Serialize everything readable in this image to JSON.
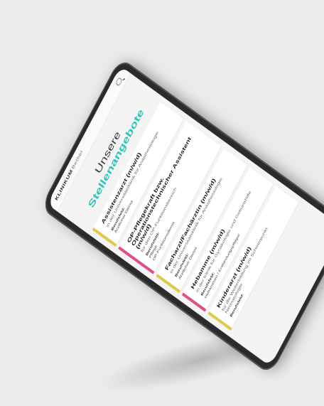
{
  "header": {
    "logo_main": "KLINIKUM",
    "logo_sub": "Bethel",
    "search_icon": "search-icon"
  },
  "page": {
    "title_prefix": "Unsere",
    "title_accent": "Stellenangebote",
    "accent_color": "#2ec4b6"
  },
  "jobs": [
    {
      "title": "Assistenzarzt (m/w/d)",
      "subtitle": "in der Universitätsklinik für Anästhesiologie",
      "label": "Berufsfeld:",
      "value1": "Ärztlicher Dienst",
      "value2": "",
      "accent": "yellow"
    },
    {
      "title": "OP-Pflegekraft bzw. Operationstechnischer Assistent (m/w/d)",
      "subtitle": "für den OP-Funktionsbereich",
      "label": "Berufsfeld:",
      "value1": "Pflege",
      "value2": "OP-Funktionsdienst",
      "accent": "pink"
    },
    {
      "title": "Facharzt/Fachärztin (m/w/d)",
      "subtitle": "in der Universitätsklinik für Anästhesiologie",
      "label": "Berufsfeld:",
      "value1": "Ärztlicher Dienst",
      "value2": "",
      "accent": "yellow"
    },
    {
      "title": "Hebamme (m/w/d)",
      "subtitle": "in der Klinik für Gynäkologie und Geburtshilfe",
      "label": "Berufsfeld:",
      "value1": "Hebammen / Entbindungspfleger",
      "value2": "",
      "accent": "pink"
    },
    {
      "title": "Kinderarzt (m/w/d)",
      "subtitle": "für die Weiterbildung im Schwerpunkt Neonatologie",
      "label": "Berufsfeld:",
      "value1": "",
      "value2": "",
      "accent": "yellow"
    }
  ]
}
